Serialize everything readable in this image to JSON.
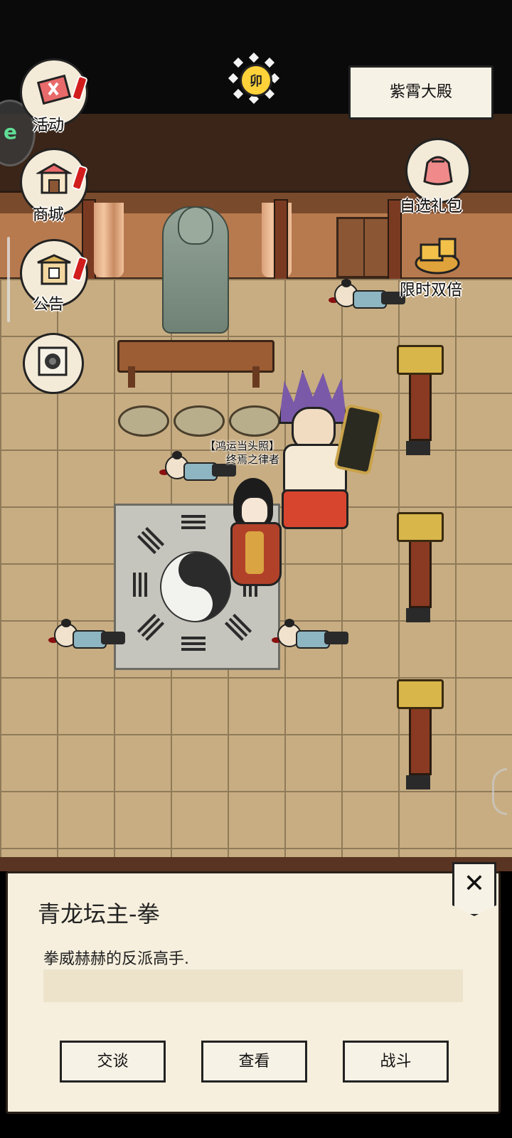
{
  "header": {
    "time_glyph": "卯",
    "location": "紫霄大殿"
  },
  "left_menu": [
    {
      "label": "活动",
      "icon": "activity-scroll-icon",
      "has_alert": true
    },
    {
      "label": "商城",
      "icon": "shop-stall-icon",
      "has_alert": true
    },
    {
      "label": "公告",
      "icon": "notice-gate-icon",
      "has_alert": true
    },
    {
      "label": "",
      "icon": "scroll-portal-icon",
      "has_alert": false
    }
  ],
  "right_menu": [
    {
      "label": "自选礼包",
      "icon": "gift-bag-icon"
    },
    {
      "label": "限时双倍",
      "icon": "gold-treasure-icon"
    }
  ],
  "side_badge": "e",
  "npc": {
    "title_line": "【鸿运当头照】",
    "name_line": "终焉之律者"
  },
  "dialog": {
    "title": "青龙坛主-拳",
    "description": "拳威赫赫的反派高手.",
    "close_glyph": "✕",
    "actions": [
      "交谈",
      "查看",
      "战斗"
    ]
  },
  "colors": {
    "floor": "#c8ad82",
    "wall": "#3a2518",
    "panel": "#f6efdd",
    "alert_red": "#d11d1d"
  }
}
